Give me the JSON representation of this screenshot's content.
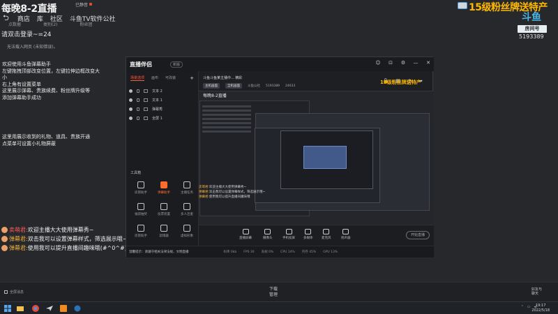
{
  "stream": {
    "title": "每晚8-2直播",
    "status_text": "已静音",
    "nav": [
      "商店",
      "库",
      "社区",
      "斗鱼TV软件公社"
    ],
    "subnav": [
      "点数据",
      "类别(2)",
      "粉丝团"
    ],
    "fan_title": "15级粉丝牌送特产",
    "logo": "斗鱼",
    "room_label": "房间号",
    "room_number": "5193389"
  },
  "overlay": {
    "login_info": "请双击登录~=24",
    "login_hint": "无法载入网页 (未知错误)。",
    "welcome_lines": [
      "欢迎使用斗鱼弹幕助手",
      "左键拖拽顶部改变位置，左键拉伸边框改变大小",
      "右上角有设置菜单",
      "这里展示弹幕、贵族续费、粉丝牌升级等",
      "添加弹幕助手成功"
    ],
    "gift_lines": [
      "这里用展示收到的礼物、道具、贵族开通",
      "点菜单可设置小礼物屏蔽"
    ]
  },
  "chat": [
    {
      "name": "卖萌君:",
      "message": "欢迎主播大大使用弹幕秀~",
      "name_color": "red"
    },
    {
      "name": "弹幕君:",
      "message": "双击我可以设置弹幕样式，筛选展示哦~"
    },
    {
      "name": "弹幕君:",
      "message": "使用我可以提升直播间趣味哦(#^0^#)"
    }
  ],
  "app": {
    "logo": "直播伴侣",
    "version": "新版",
    "window_controls": [
      "☺",
      "⊡",
      "⚙",
      "—",
      "✕"
    ],
    "scene_tabs": [
      "场景选项",
      "画布",
      "可改装"
    ],
    "scene_items": [
      "文本 2",
      "文本 1",
      "弹幕秀",
      "全屏 1"
    ],
    "tools_title": "工具箱",
    "tools": [
      "房管助手",
      "弹幕助手",
      "主播任务",
      "福袋抽奖",
      "投票装置",
      "多人连麦",
      "房管助手",
      "滤镜器",
      "虚拟形象",
      "..."
    ],
    "tools_active_index": 1,
    "header_line": "斗鱼斗鱼某主播中... 精彩",
    "header_pills": [
      "主机画面",
      "全机画面"
    ],
    "header_stats": [
      "斗鱼公社",
      "5193389",
      "24633"
    ],
    "preview_title": "每晚8-2直播",
    "preview_fan": "15级粉丝牌送特产",
    "preview_chat": [
      {
        "name": "卖萌君:",
        "message": "欢迎主播大大使用弹幕秀~"
      },
      {
        "name": "弹幕君:",
        "message": "双击我可以设置弹幕样式，筛选展示哦~"
      },
      {
        "name": "弹幕君:",
        "message": "使用我可以提升直播间趣味哦"
      }
    ],
    "bottom_buttons": [
      "直播屏幕",
      "摄像头",
      "手机投屏",
      "多媒体",
      "麦克风",
      "扬声器"
    ],
    "start_label": "开始直播",
    "footer_tip": "温馨提示：请遵守相关法律法规，文明直播",
    "footer_stats": [
      "码率 0kb",
      "FPS 30",
      "丢帧 0%",
      "CPU 14%",
      "内存 45%",
      "GPU 13%"
    ]
  },
  "bottom": {
    "left_label": "全屏消息",
    "center_top": "下载",
    "center_bottom": "管理",
    "right_line1": "好友与",
    "right_line2": "聊天"
  },
  "taskbar": {
    "time": "19:17",
    "date": "2022/5/18"
  }
}
